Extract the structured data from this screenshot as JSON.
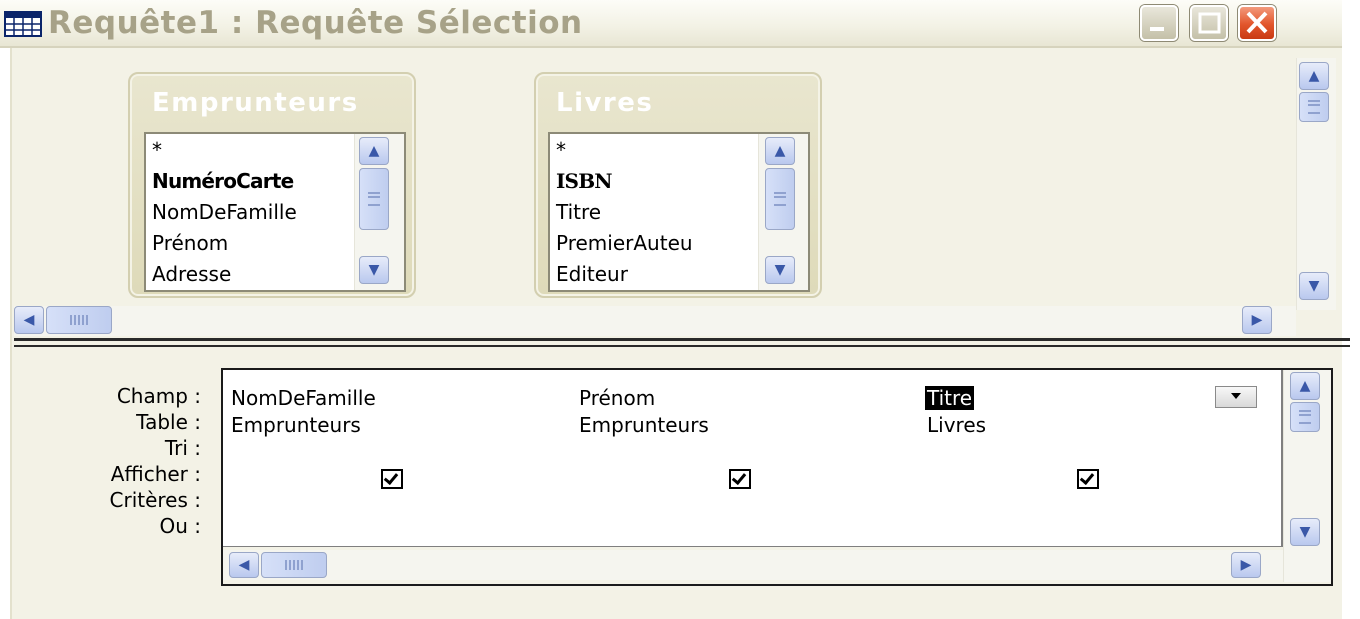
{
  "window": {
    "title": "Requête1 : Requête Sélection",
    "controls": [
      "minimize",
      "maximize",
      "close"
    ],
    "colors": {
      "title_text": "#a7a288",
      "close_button": "#e2552b",
      "panel": "#f3f2e6"
    }
  },
  "tables": [
    {
      "name": "Emprunteurs",
      "fields": [
        {
          "label": "*",
          "primary_key": false
        },
        {
          "label": "NuméroCarte",
          "primary_key": true
        },
        {
          "label": "NomDeFamille",
          "primary_key": false
        },
        {
          "label": "Prénom",
          "primary_key": false
        },
        {
          "label": "Adresse",
          "primary_key": false
        }
      ]
    },
    {
      "name": "Livres",
      "fields": [
        {
          "label": "*",
          "primary_key": false
        },
        {
          "label": "ISBN",
          "primary_key": true
        },
        {
          "label": "Titre",
          "primary_key": false
        },
        {
          "label": "PremierAuteu",
          "primary_key": false
        },
        {
          "label": "Editeur",
          "primary_key": false
        }
      ]
    }
  ],
  "grid": {
    "row_labels": {
      "field": "Champ :",
      "table": "Table :",
      "sort": "Tri :",
      "show": "Afficher :",
      "criteria": "Critères :",
      "or": "Ou :"
    },
    "columns": [
      {
        "field": "NomDeFamille",
        "table": "Emprunteurs",
        "sort": "",
        "show": true,
        "criteria": "",
        "or": ""
      },
      {
        "field": "Prénom",
        "table": "Emprunteurs",
        "sort": "",
        "show": true,
        "criteria": "",
        "or": ""
      },
      {
        "field": "Titre",
        "table": "Livres",
        "sort": "",
        "show": true,
        "criteria": "",
        "or": "",
        "selected": true
      }
    ]
  }
}
